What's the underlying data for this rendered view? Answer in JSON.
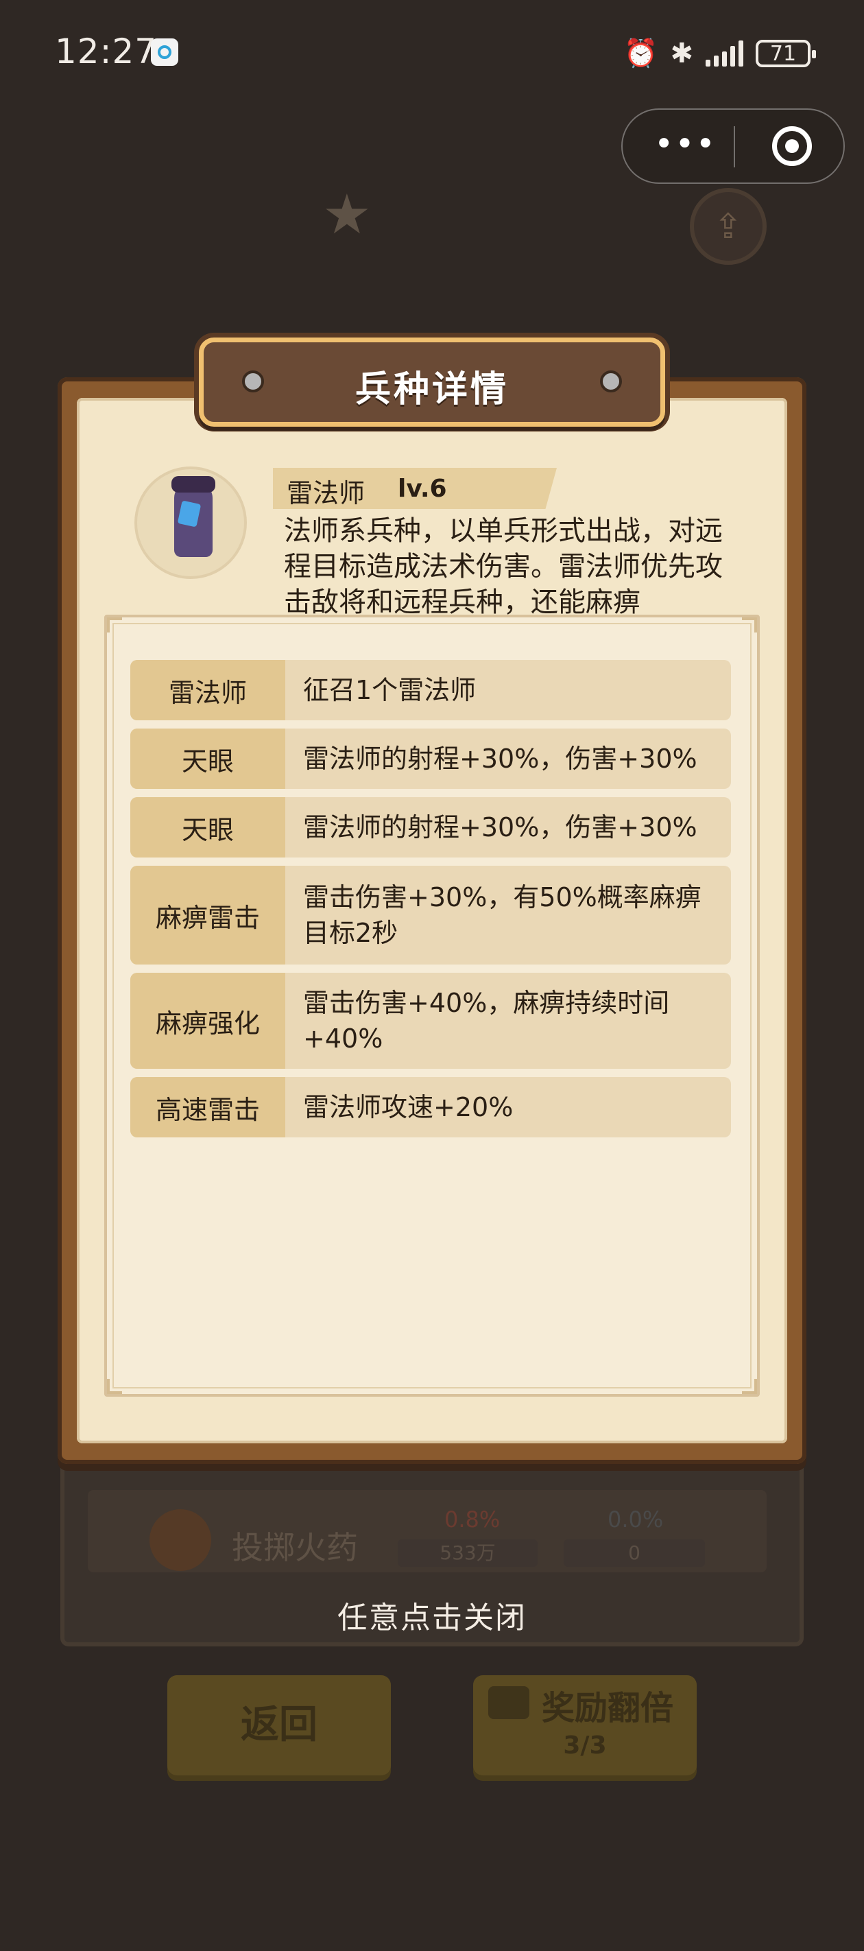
{
  "status_bar": {
    "time": "12:27",
    "battery": "71",
    "icons": [
      "alarm-icon",
      "bluetooth-icon",
      "signal-icon"
    ]
  },
  "background": {
    "row_name": "投掷火药",
    "attack_pct": "0.8%",
    "defense_pct": "0.0%",
    "attack_value": "533万",
    "defense_value": "0",
    "back_label": "返回",
    "reward_label": "奖励翻倍",
    "reward_count": "3/3"
  },
  "modal": {
    "title": "兵种详情",
    "unit": {
      "name": "雷法师",
      "level": "lv.6",
      "description": "法师系兵种，以单兵形式出战，对远程目标造成法术伤害。雷法师优先攻击敌将和远程兵种，还能麻痹"
    },
    "skills": [
      {
        "label": "雷法师",
        "desc": "征召1个雷法师"
      },
      {
        "label": "天眼",
        "desc": "雷法师的射程+30%，伤害+30%"
      },
      {
        "label": "天眼",
        "desc": "雷法师的射程+30%，伤害+30%"
      },
      {
        "label": "麻痹雷击",
        "desc": "雷击伤害+30%，有50%概率麻痹目标2秒"
      },
      {
        "label": "麻痹强化",
        "desc": "雷击伤害+40%，麻痹持续时间+40%"
      },
      {
        "label": "高速雷击",
        "desc": "雷法师攻速+20%"
      }
    ]
  },
  "close_hint": "任意点击关闭",
  "colors": {
    "background": "#2f2824",
    "paper": "#f3e6c8",
    "skill_label_bg": "#e2c791",
    "title_bar": "#6a4a35"
  }
}
